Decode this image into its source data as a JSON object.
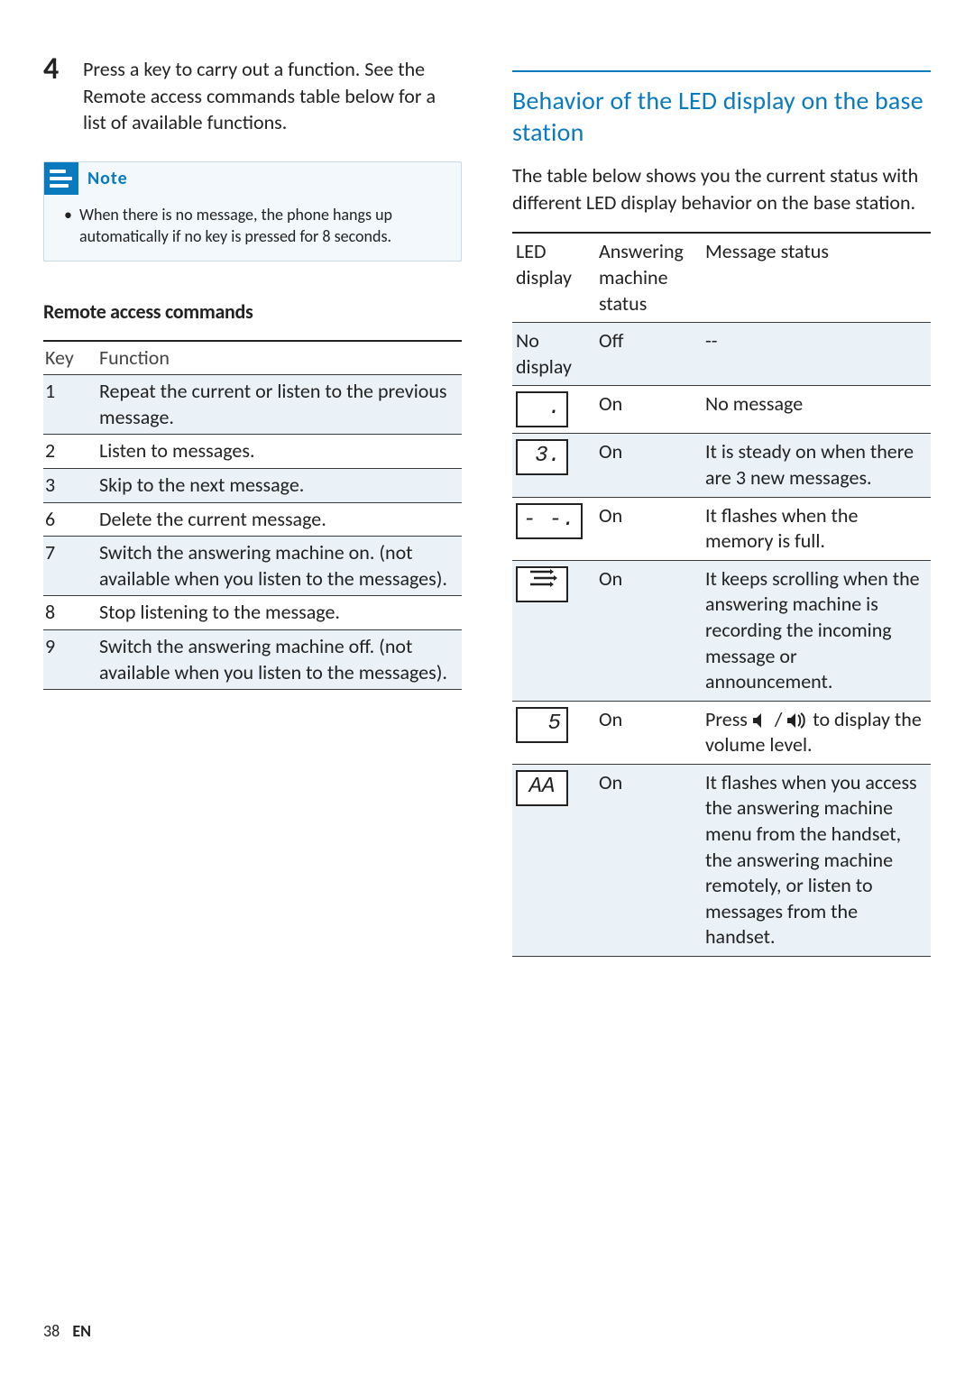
{
  "page": {
    "number": "38",
    "lang": "EN"
  },
  "left": {
    "step_number": "4",
    "step_text": "Press a key to carry out a function. See the Remote access commands table below for a list of available functions.",
    "note": {
      "label": "Note",
      "text": "When there is no message, the phone hangs up automatically if no key is pressed for 8 seconds."
    },
    "commands_heading": "Remote access commands",
    "commands_headers": {
      "key": "Key",
      "function": "Function"
    },
    "commands": [
      {
        "key": "1",
        "function": "Repeat the current or listen to the previous message."
      },
      {
        "key": "2",
        "function": "Listen to messages."
      },
      {
        "key": "3",
        "function": "Skip to the next message."
      },
      {
        "key": "6",
        "function": "Delete the current message."
      },
      {
        "key": "7",
        "function": "Switch the answering machine on. (not available when you listen to the messages)."
      },
      {
        "key": "8",
        "function": "Stop listening to the message."
      },
      {
        "key": "9",
        "function": "Switch the answering machine off. (not available when you listen to the messages)."
      }
    ]
  },
  "right": {
    "title": "Behavior of the LED display on the base station",
    "intro": "The table below shows you the current status with different LED display behavior on the base station.",
    "led_headers": {
      "display": "LED display",
      "status": "Answering machine status",
      "msg": "Message status"
    },
    "led_rows": [
      {
        "display_text": "No display",
        "status": "Off",
        "msg": "--"
      },
      {
        "display_text": ".",
        "status": "On",
        "msg": "No message"
      },
      {
        "display_text": "3.",
        "status": "On",
        "msg": "It is steady on when there are 3 new messages."
      },
      {
        "display_text": "- -.",
        "status": "On",
        "msg": "It flashes when the memory is full."
      },
      {
        "display_text": "scroll-icon",
        "status": "On",
        "msg": "It keeps scrolling when the answering machine is recording the incoming message or announcement."
      },
      {
        "display_text": "5",
        "status": "On",
        "msg_prefix": "Press ",
        "msg_suffix": " to display the volume level."
      },
      {
        "display_text": "AA",
        "status": "On",
        "msg": "It flashes when you access the answering machine menu from the handset, the answering machine remotely, or listen to messages from the handset."
      }
    ]
  }
}
